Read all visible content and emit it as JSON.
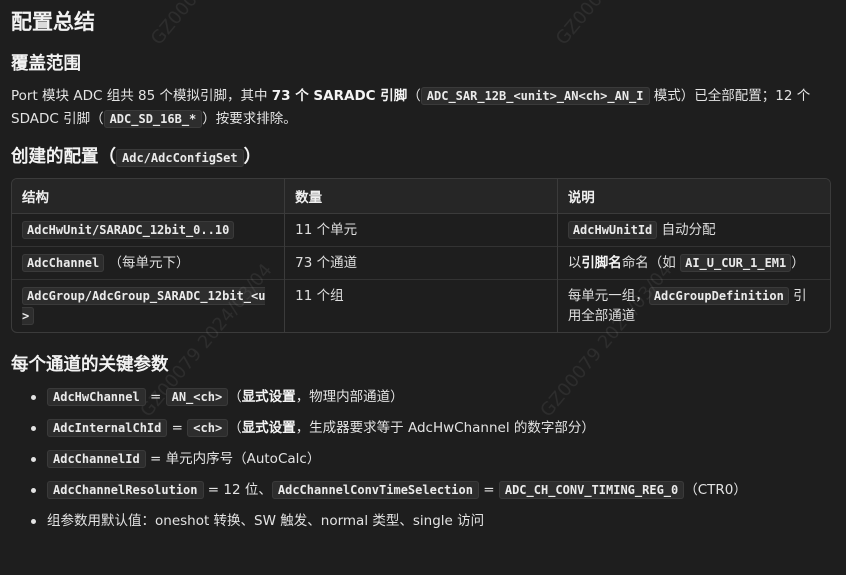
{
  "title": "配置总结",
  "coverage": {
    "heading": "覆盖范围",
    "t1": "Port 模块 ADC 组共 85 个模拟引脚，其中 ",
    "b1": "73 个 SARADC 引脚",
    "t2": "（",
    "c1": "ADC_SAR_12B_<unit>_AN<ch>_AN_I",
    "t3": " 模式）已全部配置；12 个 SDADC 引脚（",
    "c2": "ADC_SD_16B_*",
    "t4": "）按要求排除。"
  },
  "created": {
    "heading_prefix": "创建的配置（",
    "heading_code": "Adc/AdcConfigSet",
    "heading_suffix": "）",
    "columns": [
      "结构",
      "数量",
      "说明"
    ],
    "rows": [
      {
        "c1_code": "AdcHwUnit/SARADC_12bit_0..10",
        "c1_text": "",
        "c2": "11 个单元",
        "c3_code": "AdcHwUnitId",
        "c3_text": " 自动分配"
      },
      {
        "c1_code": "AdcChannel",
        "c1_text": "（每单元下）",
        "c2": "73 个通道",
        "c3_pre": "以",
        "c3_bold": "引脚名",
        "c3_mid": "命名（如 ",
        "c3_code": "AI_U_CUR_1_EM1",
        "c3_post": "）"
      },
      {
        "c1_code": "AdcGroup/AdcGroup_SARADC_12bit_<u>",
        "c1_text": "",
        "c2": "11 个组",
        "c3_pre": "每单元一组，",
        "c3_code": "AdcGroupDefinition",
        "c3_post": " 引用全部通道"
      }
    ]
  },
  "params": {
    "heading": "每个通道的关键参数",
    "i1": {
      "code1": "AdcHwChannel",
      "eq": " = ",
      "code2": "AN_<ch>",
      "pre": "（",
      "bold": "显式设置",
      "post": "，物理内部通道）"
    },
    "i2": {
      "code1": "AdcInternalChId",
      "eq": " = ",
      "code2": "<ch>",
      "pre": "（",
      "bold": "显式设置",
      "post": "，生成器要求等于 AdcHwChannel 的数字部分）"
    },
    "i3": {
      "code1": "AdcChannelId",
      "text": " = 单元内序号（AutoCalc）"
    },
    "i4": {
      "code1": "AdcChannelResolution",
      "t1": " = 12 位、",
      "code2": "AdcChannelConvTimeSelection",
      "eq": " = ",
      "code3": "ADC_CH_CONV_TIMING_REG_0",
      "t2": "（CTR0）"
    },
    "i5": {
      "text": "组参数用默认值：oneshot 转换、SW 触发、normal 类型、single 访问"
    }
  },
  "watermark": [
    "GZ00079",
    "GZ00079",
    "GZ00079 2024/03/04",
    "GZ00079 2024/03/04"
  ]
}
